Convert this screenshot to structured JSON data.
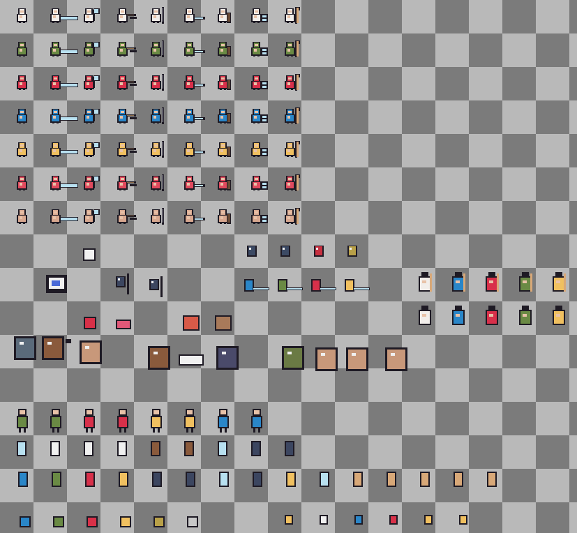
{
  "sheet": {
    "colors": {
      "checker_light": "#b9b9b9",
      "checker_dark": "#7b7b7b",
      "outline": "#1e1a24",
      "skin": "#e8c2a8",
      "weapon_light": "#b8e0f0"
    },
    "palettes": [
      {
        "name": "white",
        "body": "#f2eeea"
      },
      {
        "name": "green",
        "body": "#6a8a44"
      },
      {
        "name": "red",
        "body": "#d8304a"
      },
      {
        "name": "blue",
        "body": "#2a86c8"
      },
      {
        "name": "yellow",
        "body": "#f0c060"
      },
      {
        "name": "pink",
        "body": "#e04a5e"
      },
      {
        "name": "tan",
        "body": "#d8a890"
      }
    ],
    "hero_poses": [
      "idle",
      "sword",
      "axe",
      "crossbow",
      "spear",
      "dagger",
      "shield",
      "claw",
      "staff"
    ],
    "monsters": [
      "ghost",
      "cat-skull",
      "knight",
      "knight-spear",
      "crow",
      "slime",
      "boar",
      "centaur",
      "bear",
      "minotaur",
      "golem",
      "imp"
    ],
    "wizard_palettes": [
      "white",
      "blue",
      "red",
      "green",
      "yellow"
    ],
    "items": [
      "sword",
      "spear",
      "axe",
      "double-axe",
      "chest",
      "trapdoor",
      "flag",
      "mushroom",
      "shield",
      "dagger",
      "bow",
      "key",
      "staff",
      "potion",
      "gem"
    ]
  }
}
